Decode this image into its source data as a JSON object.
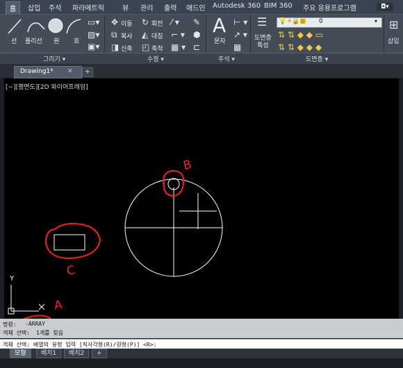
{
  "ribbon_tabs": [
    "홈",
    "삽입",
    "주석",
    "파라메트릭",
    "뷰",
    "관리",
    "출력",
    "애드인",
    "Autodesk 360",
    "BIM 360",
    "주요 응용프로그램"
  ],
  "app_button": "◘▾",
  "draw_tools": {
    "line": "선",
    "polyline": "폴리선",
    "circle": "원",
    "arc": "호"
  },
  "modify_tools": {
    "move": "이동",
    "rotate": "회전",
    "copy": "복사",
    "mirror": "대칭",
    "stretch": "신축",
    "scale": "축척"
  },
  "annotation_tools": {
    "text": "문자"
  },
  "layer_tools": {
    "layer_properties": "도면층\n특성",
    "current_layer": "0"
  },
  "insert_tool": "삽입",
  "panel_titles": {
    "draw": "그리기 ▾",
    "modify": "수정 ▾",
    "annotation": "주석 ▾",
    "layers": "도면층 ▾"
  },
  "document_tab": "Drawing1*",
  "document_tab_close": "✕",
  "new_tab": "+",
  "viewport_label": "[−][평면도][2D 와이어프레임]",
  "ucs": {
    "y": "Y",
    "x": "X"
  },
  "annotations": {
    "a": "A",
    "b": "B",
    "c": "C"
  },
  "command_history": [
    {
      "prefix": "명령:",
      "value": "-ARRAY"
    },
    {
      "prefix": "객체 선택:",
      "value": "1개를 찾음"
    }
  ],
  "command_prompt": "객체 선택:  배열의 유형 입력 [직사각형(R)/원형(P)] <R>:",
  "layout_tabs": [
    "모형",
    "배치1",
    "배치2",
    "+"
  ],
  "colors": {
    "annotation_red": "#ff1a1a",
    "drawing_lines": "#ffffff",
    "canvas": "#000000"
  }
}
